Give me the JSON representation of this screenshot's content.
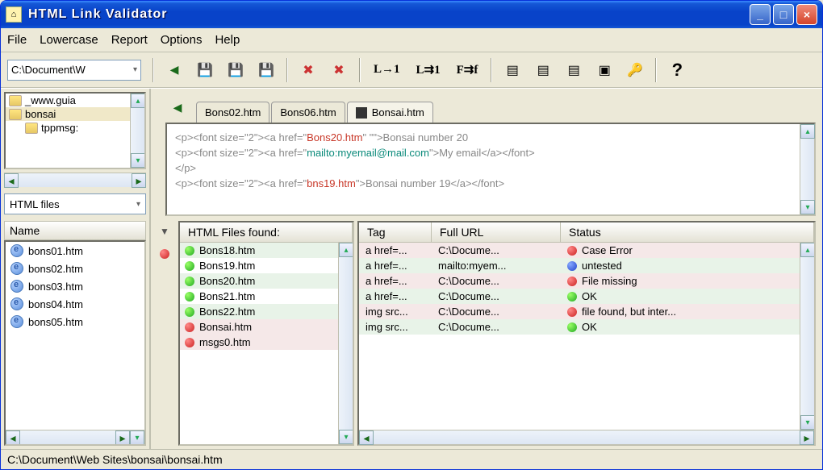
{
  "title": "HTML Link Validator",
  "menu": {
    "file": "File",
    "lowercase": "Lowercase",
    "report": "Report",
    "options": "Options",
    "help": "Help"
  },
  "toolbar": {
    "path": "C:\\Document\\W",
    "l1": "L→1",
    "l2": "L⇉1",
    "ff": "F⇉f",
    "help": "?"
  },
  "tree": {
    "n0": "_www.guia",
    "n1": "bonsai",
    "n2": "tppmsg:"
  },
  "filter": "HTML files",
  "nameHeader": "Name",
  "files": {
    "f0": "bons01.htm",
    "f1": "bons02.htm",
    "f2": "bons03.htm",
    "f3": "bons04.htm",
    "f4": "bons05.htm"
  },
  "tabs": {
    "t0": "Bons02.htm",
    "t1": "Bons06.htm",
    "t2": "Bonsai.htm"
  },
  "code": {
    "l1a": "<p><font size=\"2\"><a href=\"",
    "l1b": "Bons20.htm",
    "l1c": "\" \"\">Bonsai number 20",
    "l2a": "<p><font size=\"2\"><a href=\"",
    "l2b": "mailto:myemail@mail.com",
    "l2c": "\">My email</a></font>",
    "l3": "</p>",
    "l4a": "<p><font size=\"2\"><a href=\"",
    "l4b": "bns19.htm",
    "l4c": "\">Bonsai number 19</a></font>"
  },
  "found": {
    "hdr": "HTML Files found:",
    "r0": "Bons18.htm",
    "r1": "Bons19.htm",
    "r2": "Bons20.htm",
    "r3": "Bons21.htm",
    "r4": "Bons22.htm",
    "r5": "Bonsai.htm",
    "r6": "msgs0.htm"
  },
  "grid": {
    "h0": "Tag",
    "h1": "Full URL",
    "h2": "Status",
    "rows": [
      {
        "tag": "a href=...",
        "url": "C:\\Docume...",
        "status": "Case Error",
        "dot": "red",
        "cls": "err"
      },
      {
        "tag": "a href=...",
        "url": "mailto:myem...",
        "status": "untested",
        "dot": "blue",
        "cls": "odd"
      },
      {
        "tag": "a href=...",
        "url": "C:\\Docume...",
        "status": "File missing",
        "dot": "red",
        "cls": "err"
      },
      {
        "tag": "a href=...",
        "url": "C:\\Docume...",
        "status": "OK",
        "dot": "green",
        "cls": "odd"
      },
      {
        "tag": "img src...",
        "url": "C:\\Docume...",
        "status": "file found, but inter...",
        "dot": "red",
        "cls": "err"
      },
      {
        "tag": "img src...",
        "url": "C:\\Docume...",
        "status": "OK",
        "dot": "green",
        "cls": "odd"
      }
    ]
  },
  "status": "C:\\Document\\Web Sites\\bonsai\\bonsai.htm"
}
